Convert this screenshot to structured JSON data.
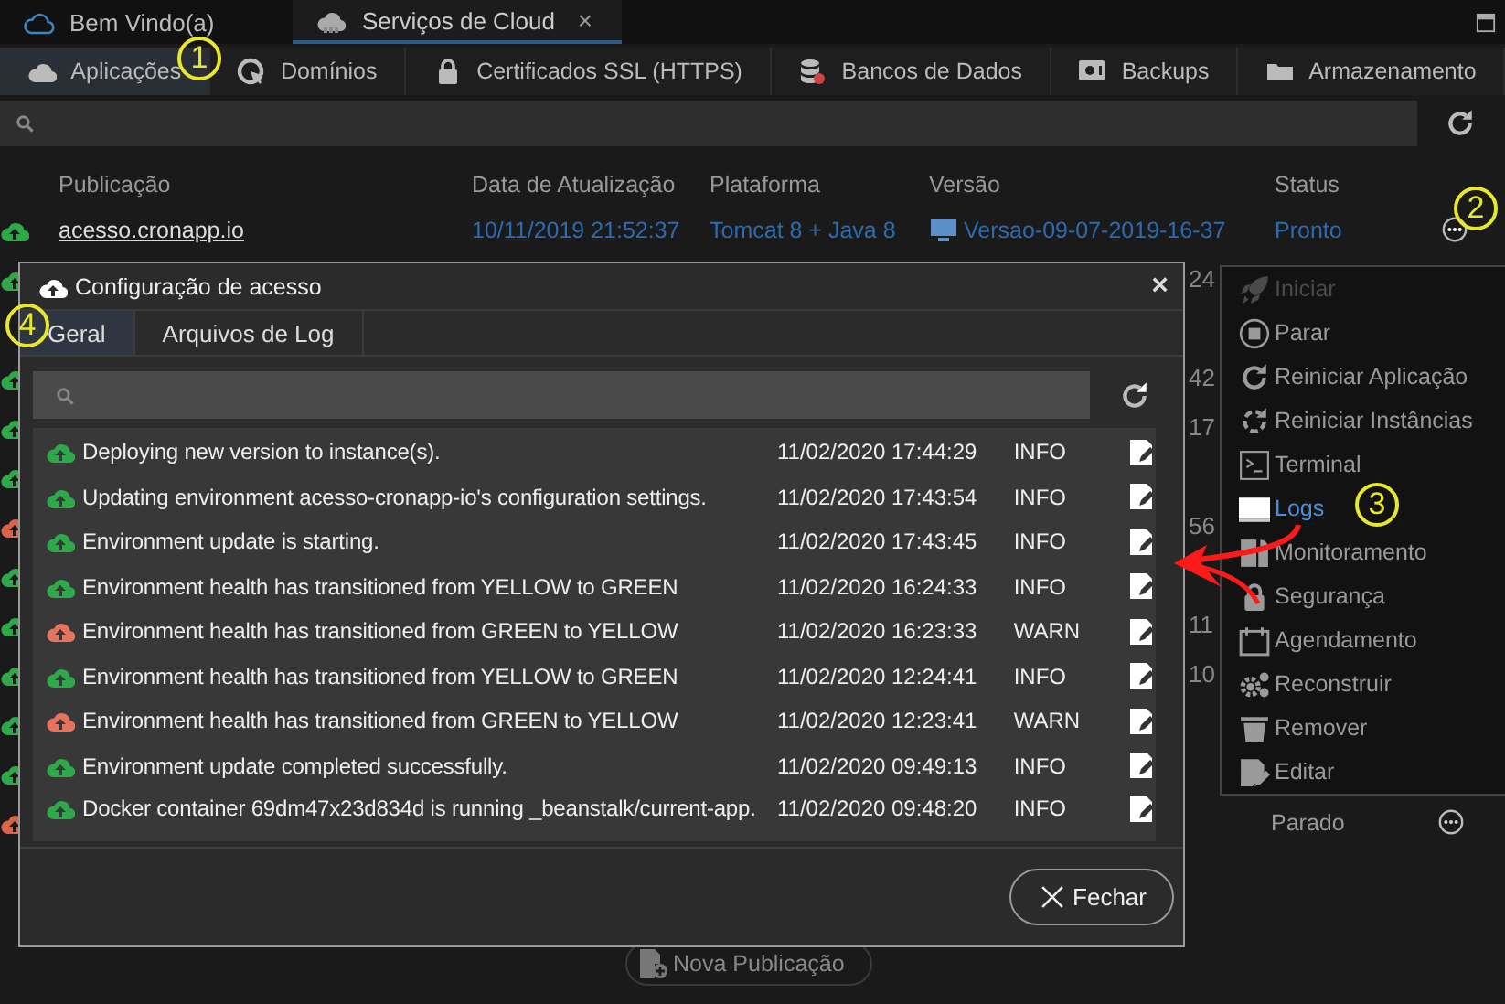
{
  "window_tabs": [
    {
      "label": "Bem Vindo(a)",
      "selected": false
    },
    {
      "label": "Serviços de Cloud",
      "selected": true,
      "close": "×"
    }
  ],
  "service_tabs": [
    {
      "label": "Aplicações",
      "selected": true
    },
    {
      "label": "Domínios",
      "selected": false
    },
    {
      "label": "Certificados SSL (HTTPS)",
      "selected": false
    },
    {
      "label": "Bancos de Dados",
      "selected": false
    },
    {
      "label": "Backups",
      "selected": false
    },
    {
      "label": "Armazenamento",
      "selected": false
    }
  ],
  "table": {
    "columns": [
      "Publicação",
      "Data de Atualização",
      "Plataforma",
      "Versão",
      "Status"
    ],
    "rows": [
      {
        "kind": "full",
        "color": "#2ea84a",
        "publication": "acesso.cronapp.io",
        "updated": "10/11/2019 21:52:37",
        "platform": "Tomcat 8 + Java 8",
        "version": "Versao-09-07-2019-16-37",
        "status": "Pronto"
      },
      {
        "kind": "fragment",
        "color": "#2ea84a",
        "tail": "24"
      },
      {
        "kind": "fragment"
      },
      {
        "kind": "fragment",
        "color": "#2ea84a",
        "tail": "42"
      },
      {
        "kind": "fragment",
        "color": "#2ea84a",
        "tail": "17"
      },
      {
        "kind": "fragment",
        "color": "#2ea84a"
      },
      {
        "kind": "fragment",
        "color": "#d9644c",
        "tail": "56"
      },
      {
        "kind": "fragment",
        "color": "#2ea84a"
      },
      {
        "kind": "fragment",
        "color": "#2ea84a",
        "tail": "11"
      },
      {
        "kind": "fragment",
        "color": "#2ea84a",
        "tail": "10"
      },
      {
        "kind": "fragment",
        "color": "#2ea84a"
      },
      {
        "kind": "fragment",
        "color": "#2ea84a"
      },
      {
        "kind": "status",
        "color": "#d9644c",
        "status": "Parado"
      }
    ]
  },
  "new_button": "Nova Publicação",
  "modal": {
    "title": "Configuração de acesso",
    "close": "×",
    "tabs": [
      {
        "label": "Geral",
        "selected": true
      },
      {
        "label": "Arquivos de Log",
        "selected": false
      }
    ],
    "logs": [
      {
        "message": "Deploying new version to instance(s).",
        "date": "11/02/2020 17:44:29",
        "level": "INFO",
        "color": "#2ea84a"
      },
      {
        "message": "Updating environment acesso-cronapp-io's configuration settings.",
        "date": "11/02/2020 17:43:54",
        "level": "INFO",
        "color": "#2ea84a"
      },
      {
        "message": "Environment update is starting.",
        "date": "11/02/2020 17:43:45",
        "level": "INFO",
        "color": "#2ea84a"
      },
      {
        "message": "Environment health has transitioned from YELLOW to GREEN",
        "date": "11/02/2020 16:24:33",
        "level": "INFO",
        "color": "#2ea84a"
      },
      {
        "message": "Environment health has transitioned from GREEN to YELLOW",
        "date": "11/02/2020 16:23:33",
        "level": "WARN",
        "color": "#e5735e"
      },
      {
        "message": "Environment health has transitioned from YELLOW to GREEN",
        "date": "11/02/2020 12:24:41",
        "level": "INFO",
        "color": "#2ea84a"
      },
      {
        "message": "Environment health has transitioned from GREEN to YELLOW",
        "date": "11/02/2020 12:23:41",
        "level": "WARN",
        "color": "#e5735e"
      },
      {
        "message": "Environment update completed successfully.",
        "date": "11/02/2020 09:49:13",
        "level": "INFO",
        "color": "#2ea84a"
      },
      {
        "message": "Docker container 69dm47x23d834d is running _beanstalk/current-app.",
        "date": "11/02/2020 09:48:20",
        "level": "INFO",
        "color": "#2ea84a"
      }
    ],
    "close_button": "Fechar"
  },
  "menu": {
    "items": [
      {
        "label": "Iniciar",
        "disabled": true,
        "selected": false
      },
      {
        "label": "Parar",
        "disabled": false,
        "selected": false
      },
      {
        "label": "Reiniciar Aplicação",
        "disabled": false,
        "selected": false
      },
      {
        "label": "Reiniciar Instâncias",
        "disabled": false,
        "selected": false
      },
      {
        "label": "Terminal",
        "disabled": false,
        "selected": false
      },
      {
        "label": "Logs",
        "disabled": false,
        "selected": true
      },
      {
        "label": "Monitoramento",
        "disabled": false,
        "selected": false
      },
      {
        "label": "Segurança",
        "disabled": false,
        "selected": false
      },
      {
        "label": "Agendamento",
        "disabled": false,
        "selected": false
      },
      {
        "label": "Reconstruir",
        "disabled": false,
        "selected": false
      },
      {
        "label": "Remover",
        "disabled": false,
        "selected": false
      },
      {
        "label": "Editar",
        "disabled": false,
        "selected": false
      }
    ]
  },
  "annotations": [
    "1",
    "2",
    "3",
    "4"
  ]
}
